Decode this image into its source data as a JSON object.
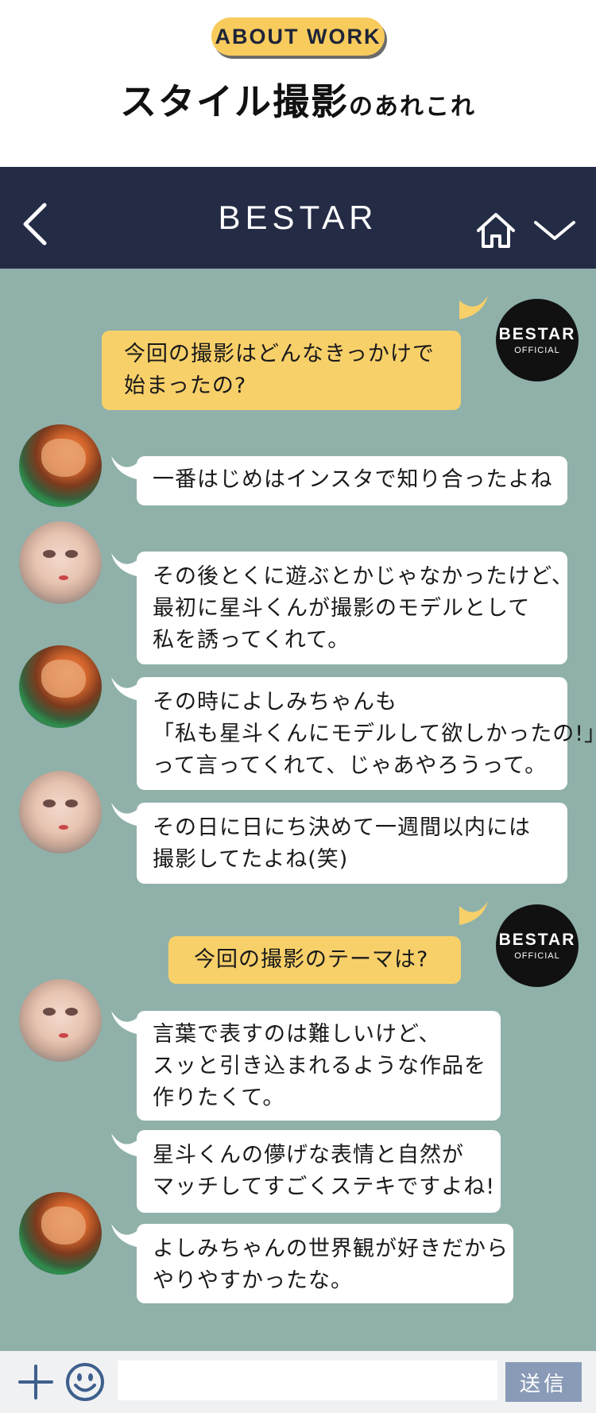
{
  "header": {
    "badge": "ABOUT WORK",
    "title_main": "スタイル撮影",
    "title_suffix": "のあれこれ"
  },
  "navbar": {
    "brand": "BESTAR",
    "icons": [
      "back-chevron-icon",
      "home-icon",
      "chevron-down-icon"
    ]
  },
  "official_avatar": {
    "line1": "BESTAR",
    "line2": "OFFICIAL"
  },
  "messages": [
    {
      "sender": "BESTAR OFFICIAL",
      "lines": [
        "今回の撮影はどんなきっかけで",
        "始まったの?"
      ]
    },
    {
      "sender": "man",
      "lines": [
        "一番はじめはインスタで知り合ったよね"
      ]
    },
    {
      "sender": "woman",
      "lines": [
        "その後とくに遊ぶとかじゃなかったけど、",
        "最初に星斗くんが撮影のモデルとして",
        "私を誘ってくれて。"
      ]
    },
    {
      "sender": "man",
      "lines": [
        "その時によしみちゃんも",
        "「私も星斗くんにモデルして欲しかったの!」",
        "って言ってくれて、じゃあやろうって。"
      ]
    },
    {
      "sender": "woman",
      "lines": [
        "その日に日にち決めて一週間以内には",
        "撮影してたよね(笑)"
      ]
    },
    {
      "sender": "BESTAR OFFICIAL",
      "lines": [
        "今回の撮影のテーマは?"
      ]
    },
    {
      "sender": "woman",
      "lines": [
        "言葉で表すのは難しいけど、",
        "スッと引き込まれるような作品を",
        "作りたくて。"
      ]
    },
    {
      "sender": "woman",
      "lines": [
        "星斗くんの儚げな表情と自然が",
        "マッチしてすごくステキですよね!"
      ]
    },
    {
      "sender": "man",
      "lines": [
        "よしみちゃんの世界観が好きだから",
        "やりやすかったな。"
      ]
    }
  ],
  "input_bar": {
    "placeholder": "",
    "send_label": "送信"
  },
  "colors": {
    "navbar": "#242c45",
    "chat_background": "#8fb1aa",
    "official_bubble": "#f8d06a",
    "reply_bubble": "#ffffff",
    "badge": "#f8cb5d",
    "send_button": "#8a9bb8"
  }
}
